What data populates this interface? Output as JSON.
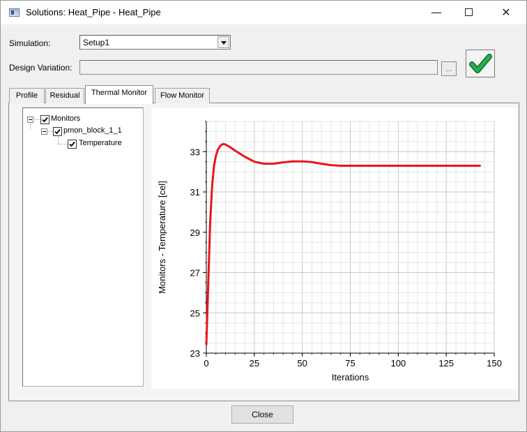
{
  "window": {
    "title": "Solutions: Heat_Pipe - Heat_Pipe",
    "minimize_glyph": "—",
    "close_glyph": "✕"
  },
  "simulation": {
    "label": "Simulation:",
    "value": "Setup1"
  },
  "design_variation": {
    "label": "Design Variation:",
    "value": "",
    "browse_label": "..."
  },
  "tabs": [
    {
      "label": "Profile",
      "active": false
    },
    {
      "label": "Residual",
      "active": false
    },
    {
      "label": "Thermal Monitor",
      "active": true
    },
    {
      "label": "Flow Monitor",
      "active": false
    }
  ],
  "tree": {
    "root": {
      "label": "Monitors",
      "checked": true
    },
    "child": {
      "label": "pmon_block_1_1",
      "checked": true
    },
    "leaf": {
      "label": "Temperature",
      "checked": true
    }
  },
  "chart_data": {
    "type": "line",
    "xlabel": "Iterations",
    "ylabel": "Monitors - Temperature [cel]",
    "xlim": [
      0,
      150
    ],
    "ylim": [
      23,
      34.5
    ],
    "xticks": [
      "0",
      "25",
      "50",
      "75",
      "100",
      "125",
      "150"
    ],
    "yticks": [
      "23",
      "25",
      "27",
      "29",
      "31",
      "33"
    ],
    "grid": true,
    "series": [
      {
        "color": "#e8161c",
        "x": [
          0,
          1,
          2,
          3,
          4,
          5,
          6,
          7,
          8,
          9,
          10,
          12,
          15,
          20,
          25,
          30,
          35,
          40,
          45,
          50,
          55,
          60,
          65,
          70,
          80,
          90,
          100,
          110,
          120,
          130,
          143
        ],
        "y": [
          23.4,
          26.5,
          29.5,
          31.3,
          32.3,
          32.8,
          33.1,
          33.25,
          33.35,
          33.38,
          33.35,
          33.25,
          33.05,
          32.75,
          32.5,
          32.4,
          32.4,
          32.47,
          32.52,
          32.52,
          32.48,
          32.4,
          32.33,
          32.3,
          32.3,
          32.3,
          32.3,
          32.3,
          32.3,
          32.3,
          32.3
        ]
      }
    ]
  },
  "buttons": {
    "close_label": "Close"
  },
  "colors": {
    "accent_check": "#22b14c",
    "series": "#e8161c"
  }
}
